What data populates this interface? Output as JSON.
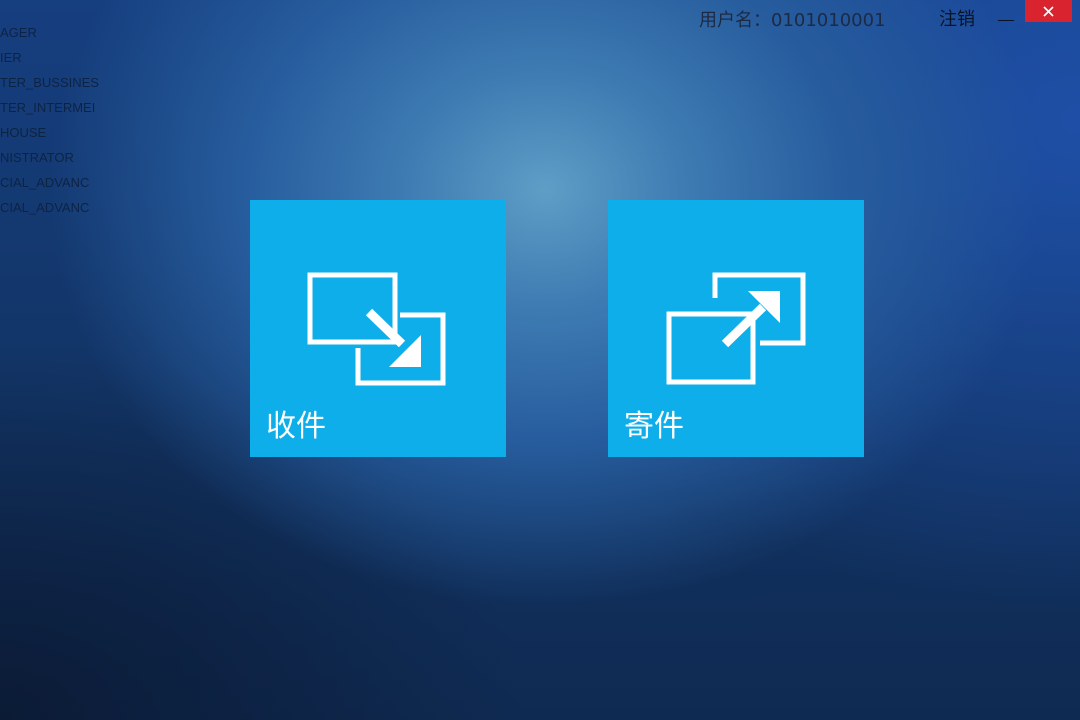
{
  "window": {
    "user_label": "用户名：0101010001",
    "logout_label": "注销",
    "minimize_label": "—",
    "close_icon": "close-icon",
    "close_color": "#d9232f"
  },
  "background_list": [
    "AGER",
    "IER",
    "TER_BUSSINES",
    "TER_INTERMEI",
    "HOUSE",
    "NISTRATOR",
    "CIAL_ADVANC",
    "CIAL_ADVANC"
  ],
  "tiles": [
    {
      "label": "收件",
      "icon": "receive-icon",
      "color": "#0eaeea"
    },
    {
      "label": "寄件",
      "icon": "send-icon",
      "color": "#0eaeea"
    }
  ]
}
